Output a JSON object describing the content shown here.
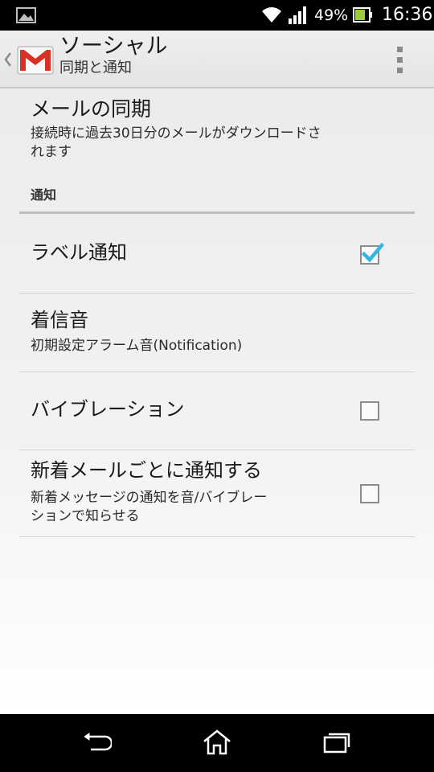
{
  "status_bar": {
    "battery_percent": "49%",
    "time": "16:36",
    "icons": [
      "image-notification-icon",
      "wifi-icon",
      "signal-icon",
      "battery-charging-icon"
    ]
  },
  "action_bar": {
    "title": "ソーシャル",
    "subtitle": "同期と通知",
    "app_icon": "gmail-icon",
    "colors": {
      "gmail_red": "#d93025",
      "check_blue": "#33b5e5"
    }
  },
  "settings": {
    "mail_sync": {
      "title": "メールの同期",
      "summary_line1": "接続時に過去30日分のメールがダウンロードさ",
      "summary_line2": "れます"
    },
    "category": "通知",
    "label_notification": {
      "title": "ラベル通知",
      "checked": true
    },
    "ringtone": {
      "title": "着信音",
      "summary": "初期設定アラーム音(Notification)"
    },
    "vibration": {
      "title": "バイブレーション",
      "checked": false
    },
    "notify_each": {
      "title": "新着メールごとに通知する",
      "summary_line1": "新着メッセージの通知を音/バイブレー",
      "summary_line2": "ションで知らせる",
      "checked": false
    }
  },
  "nav_bar": {
    "icons": [
      "back-icon",
      "home-icon",
      "recent-apps-icon"
    ]
  }
}
